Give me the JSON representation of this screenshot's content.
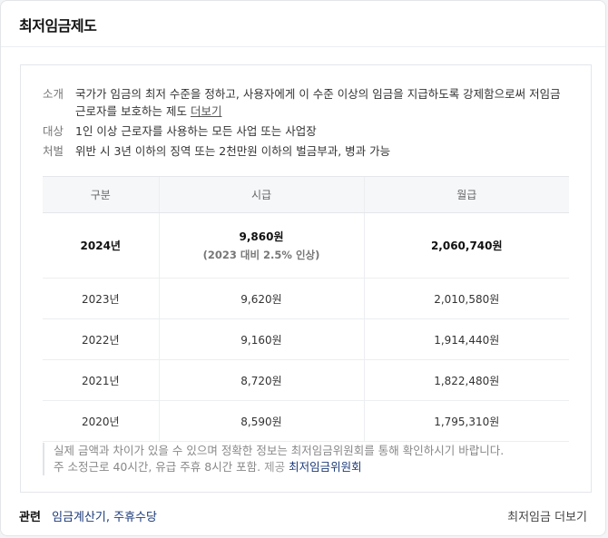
{
  "title": "최저임금제도",
  "info": {
    "intro_label": "소개",
    "intro_text": "국가가 임금의 최저 수준을 정하고, 사용자에게 이 수준 이상의 임금을 지급하도록 강제함으로써 저임금 근로자를 보호하는 제도",
    "intro_more": "더보기",
    "target_label": "대상",
    "target_text": "1인 이상 근로자를 사용하는 모든 사업 또는 사업장",
    "penalty_label": "처벌",
    "penalty_text": "위반 시 3년 이하의 징역 또는 2천만원 이하의 벌금부과, 병과 가능"
  },
  "table": {
    "headers": [
      "구분",
      "시급",
      "월급"
    ],
    "highlight": {
      "year": "2024년",
      "hourly": "9,860원",
      "hourly_note": "(2023 대비 2.5% 인상)",
      "monthly": "2,060,740원"
    },
    "rows": [
      {
        "year": "2023년",
        "hourly": "9,620원",
        "monthly": "2,010,580원"
      },
      {
        "year": "2022년",
        "hourly": "9,160원",
        "monthly": "1,914,440원"
      },
      {
        "year": "2021년",
        "hourly": "8,720원",
        "monthly": "1,822,480원"
      },
      {
        "year": "2020년",
        "hourly": "8,590원",
        "monthly": "1,795,310원"
      }
    ]
  },
  "note": {
    "line1": "실제 금액과 차이가 있을 수 있으며 정확한 정보는 최저임금위원회를 통해 확인하시기 바랍니다.",
    "line2": "주 소정근로 40시간, 유급 주휴 8시간 포함.",
    "source_label": "제공",
    "source_link": "최저임금위원회"
  },
  "footer": {
    "related_label": "관련",
    "related_links": [
      "임금계산기",
      "주휴수당"
    ],
    "more": "최저임금 더보기"
  }
}
